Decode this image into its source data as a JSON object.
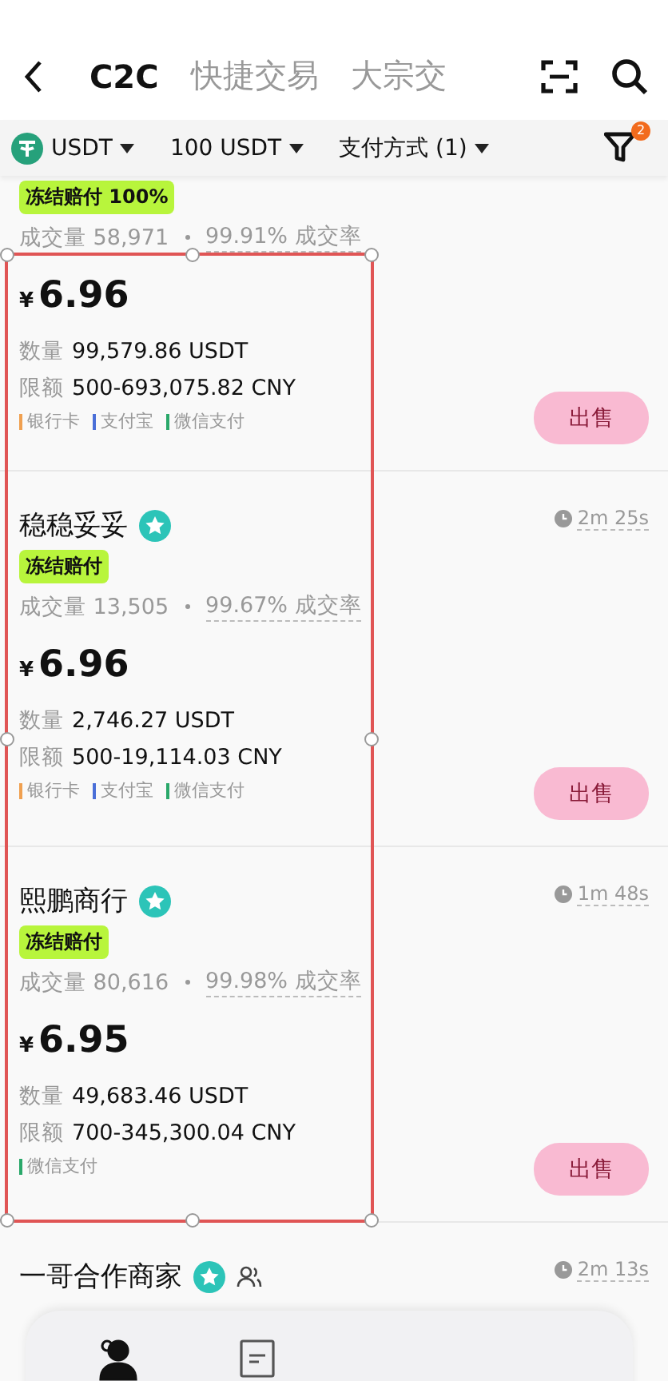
{
  "header": {
    "tabs": [
      {
        "label": "C2C",
        "selected": true
      },
      {
        "label": "快捷交易",
        "selected": false
      },
      {
        "label": "大宗交",
        "selected": false
      }
    ]
  },
  "filters": {
    "items": [
      {
        "kind": "coin",
        "label": "USDT"
      },
      {
        "kind": "plain",
        "label": "100 USDT"
      },
      {
        "kind": "plain",
        "label": "支付方式 (1)"
      }
    ],
    "filter_count": "2"
  },
  "listings": [
    {
      "badge": "冻结赔付 100%",
      "volume": "成交量 58,971",
      "rate": "99.91% 成交率",
      "currency": "¥",
      "price": "6.96",
      "quantity_label": "数量",
      "quantity": "99,579.86 USDT",
      "limit_label": "限额",
      "limit": "500-693,075.82 CNY",
      "payments": [
        {
          "label": "银行卡",
          "color": "#f0a050"
        },
        {
          "label": "支付宝",
          "color": "#4a6fd8"
        },
        {
          "label": "微信支付",
          "color": "#2aa86a"
        }
      ],
      "action": "出售"
    },
    {
      "name": "稳稳妥妥",
      "verified": true,
      "time": "2m 25s",
      "badge": "冻结赔付",
      "volume": "成交量 13,505",
      "rate": "99.67% 成交率",
      "currency": "¥",
      "price": "6.96",
      "quantity_label": "数量",
      "quantity": "2,746.27 USDT",
      "limit_label": "限额",
      "limit": "500-19,114.03 CNY",
      "payments": [
        {
          "label": "银行卡",
          "color": "#f0a050"
        },
        {
          "label": "支付宝",
          "color": "#4a6fd8"
        },
        {
          "label": "微信支付",
          "color": "#2aa86a"
        }
      ],
      "action": "出售"
    },
    {
      "name": "熙鹏商行",
      "verified": true,
      "time": "1m 48s",
      "badge": "冻结赔付",
      "volume": "成交量 80,616",
      "rate": "99.98% 成交率",
      "currency": "¥",
      "price": "6.95",
      "quantity_label": "数量",
      "quantity": "49,683.46 USDT",
      "limit_label": "限额",
      "limit": "700-345,300.04 CNY",
      "payments": [
        {
          "label": "微信支付",
          "color": "#2aa86a"
        }
      ],
      "action": "出售"
    },
    {
      "name": "一哥合作商家",
      "verified": true,
      "group": true,
      "time": "2m 13s"
    }
  ],
  "bottom_nav": [
    {
      "kind": "people",
      "selected": true
    },
    {
      "kind": "document",
      "selected": false
    }
  ]
}
